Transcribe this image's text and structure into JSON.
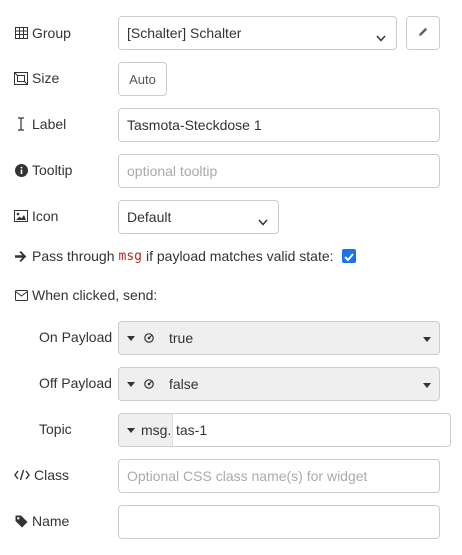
{
  "group": {
    "label": "Group",
    "value": "[Schalter] Schalter",
    "edit_icon": "pencil-icon"
  },
  "size": {
    "label": "Size",
    "value": "Auto"
  },
  "label_field": {
    "label": "Label",
    "value": "Tasmota-Steckdose 1"
  },
  "tooltip": {
    "label": "Tooltip",
    "placeholder": "optional tooltip"
  },
  "icon_field": {
    "label": "Icon",
    "value": "Default"
  },
  "passthru": {
    "prefix": "Pass through",
    "code": "msg",
    "suffix": "if payload matches valid state:",
    "checked": true
  },
  "when_clicked": {
    "label": "When clicked, send:"
  },
  "on_payload": {
    "label": "On Payload",
    "type_icon": "boolean-icon",
    "value": "true"
  },
  "off_payload": {
    "label": "Off Payload",
    "type_icon": "boolean-icon",
    "value": "false"
  },
  "topic": {
    "label": "Topic",
    "prefix": "msg.",
    "value": "tas-1"
  },
  "class_field": {
    "label": "Class",
    "placeholder": "Optional CSS class name(s) for widget"
  },
  "name_field": {
    "label": "Name",
    "value": ""
  },
  "colors": {
    "checkbox": "#1a73e8",
    "border": "#cccccc",
    "dropdown_bg": "#efefef",
    "code": "#b72828"
  }
}
